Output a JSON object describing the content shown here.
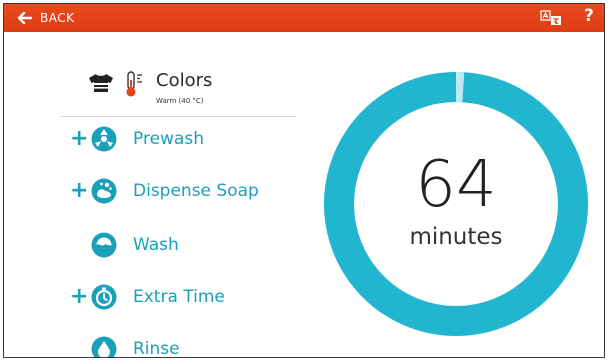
{
  "topbar": {
    "back_label": "BACK",
    "back_icon": "arrow-left-icon",
    "language_icon": "translate-icon",
    "help_label": "?",
    "color": "#e2411a"
  },
  "program": {
    "icons": [
      "shirt-icon",
      "thermometer-icon"
    ],
    "name": "Colors",
    "temperature": "Warm (40 °C)"
  },
  "steps": [
    {
      "label": "Prewash",
      "addable": true,
      "icon": "prewash-icon"
    },
    {
      "label": "Dispense Soap",
      "addable": true,
      "icon": "dispense-soap-icon"
    },
    {
      "label": "Wash",
      "addable": false,
      "icon": "wash-icon"
    },
    {
      "label": "Extra Time",
      "addable": true,
      "icon": "extra-time-icon"
    },
    {
      "label": "Rinse",
      "addable": false,
      "icon": "rinse-icon"
    }
  ],
  "timer": {
    "value": "64",
    "unit": "minutes",
    "progress_fraction": 0.01,
    "ring_color": "#22b5cf",
    "progress_color": "#bfe9f2"
  },
  "colors": {
    "accent": "#1aa0b8",
    "ring": "#22b5cf",
    "bar": "#e2411a"
  }
}
